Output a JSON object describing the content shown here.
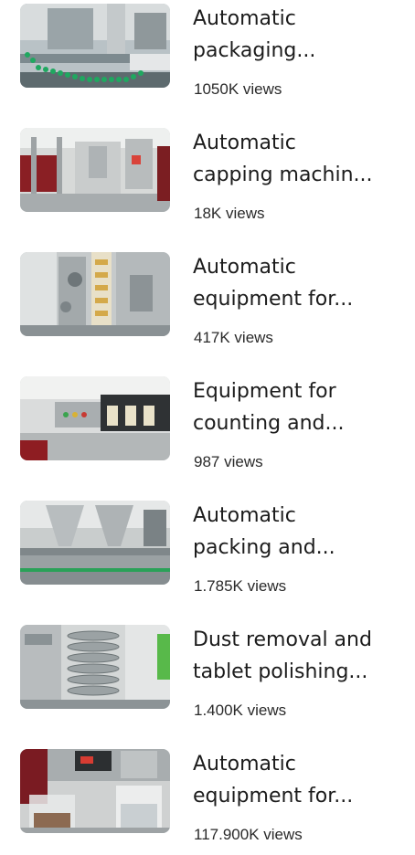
{
  "videos": [
    {
      "title_line1": "Automatic",
      "title_line2": "packaging...",
      "views": "1050K views",
      "thumbnail": "packaging-line-bottles-thumbnail"
    },
    {
      "title_line1": "Automatic",
      "title_line2": "capping machin...",
      "views": "18K views",
      "thumbnail": "capping-machine-thumbnail"
    },
    {
      "title_line1": "Automatic",
      "title_line2": "equipment for...",
      "views": "417K views",
      "thumbnail": "filling-equipment-thumbnail"
    },
    {
      "title_line1": "Equipment for",
      "title_line2": "counting and...",
      "views": "987 views",
      "thumbnail": "counting-machine-thumbnail"
    },
    {
      "title_line1": "Automatic",
      "title_line2": "packing and...",
      "views": "1.785K views",
      "thumbnail": "hopper-packing-thumbnail"
    },
    {
      "title_line1": "Dust removal and",
      "title_line2": "tablet polishing...",
      "views": "1.400K views",
      "thumbnail": "tablet-deduster-thumbnail"
    },
    {
      "title_line1": "Automatic",
      "title_line2": "equipment for...",
      "views": "117.900K views",
      "thumbnail": "lab-beaker-equipment-thumbnail"
    }
  ]
}
